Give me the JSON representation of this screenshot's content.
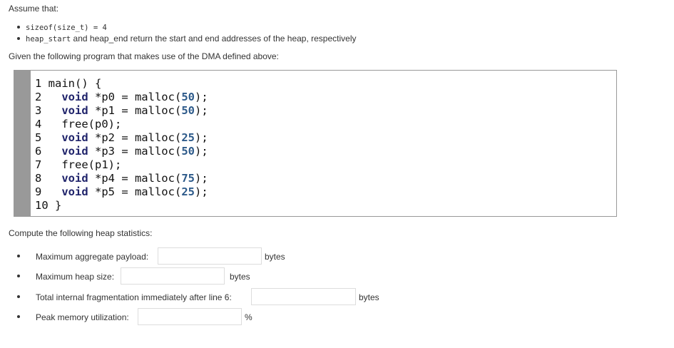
{
  "intro": "Assume that:",
  "assumptions": [
    {
      "code": "sizeof(size_t) = 4",
      "text": ""
    },
    {
      "code": "heap_start",
      "text": " and heap_end return the start and end addresses of the heap, respectively"
    }
  ],
  "given": "Given the following program that makes use of the DMA defined above:",
  "code_lines": [
    "1 main() {",
    "2   void *p0 = malloc(50);",
    "3   void *p1 = malloc(50);",
    "4   free(p0);",
    "5   void *p2 = malloc(25);",
    "6   void *p3 = malloc(50);",
    "7   free(p1);",
    "8   void *p4 = malloc(75);",
    "9   void *p5 = malloc(25);",
    "10 }"
  ],
  "compute": "Compute the following heap statistics:",
  "questions": [
    {
      "label": "Maximum aggregate payload:",
      "value": "",
      "unit": "bytes"
    },
    {
      "label": "Maximum heap size:",
      "value": "",
      "unit": "bytes"
    },
    {
      "label": "Total internal fragmentation immediately after line 6:",
      "value": "",
      "unit": "bytes"
    },
    {
      "label": "Peak memory utilization:",
      "value": "",
      "unit": "%"
    }
  ]
}
